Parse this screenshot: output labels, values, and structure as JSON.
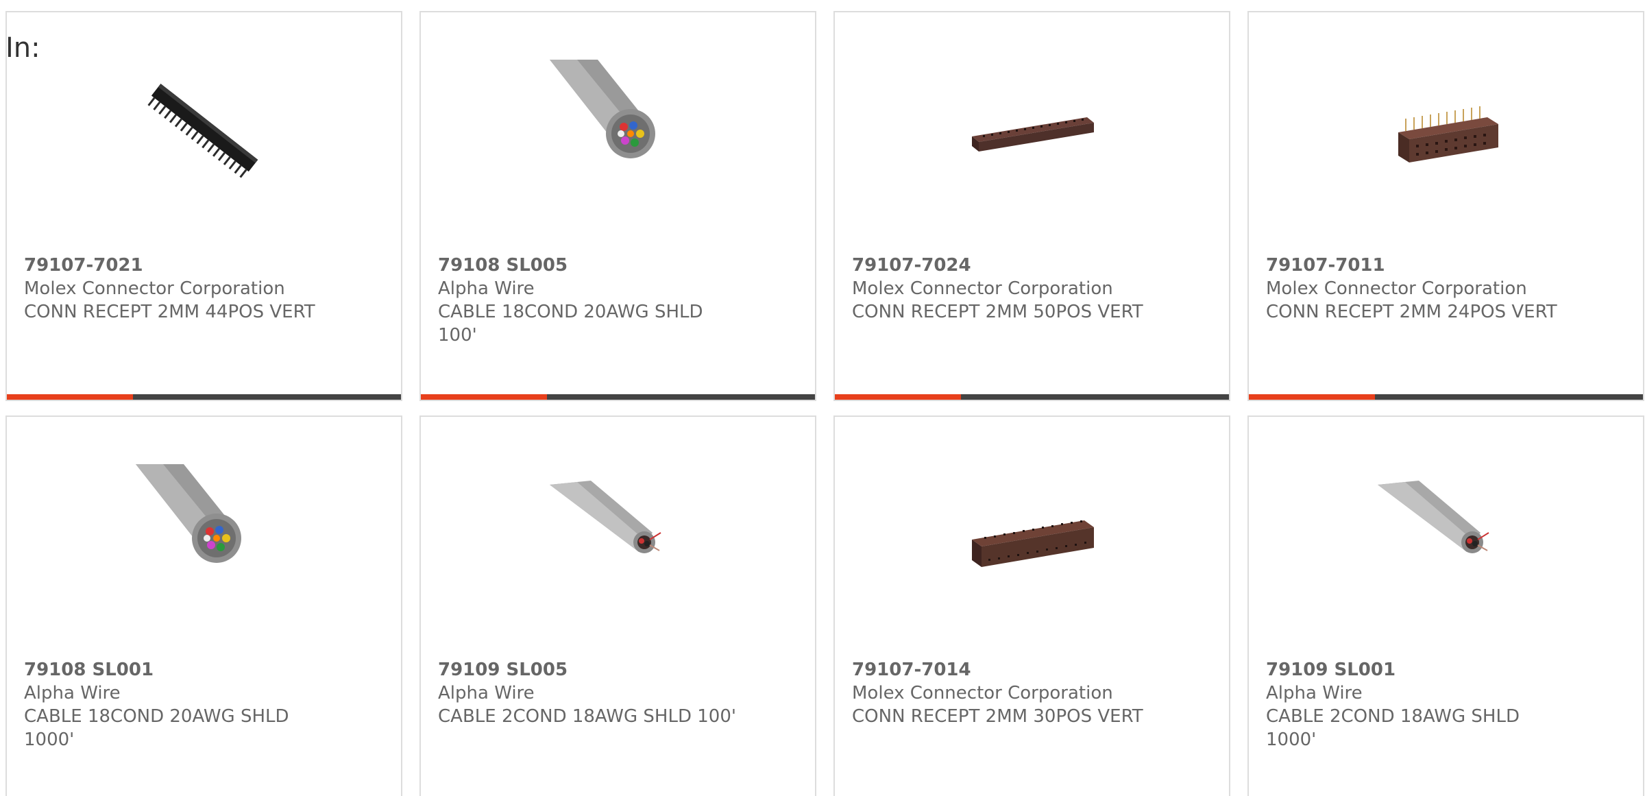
{
  "header": {
    "label": "In:"
  },
  "accent": {
    "active": "#e8401c",
    "track": "#444444"
  },
  "products": [
    {
      "part_number": "79107-7021",
      "manufacturer": "Molex Connector Corporation",
      "description": "CONN RECEPT 2MM 44POS VERT",
      "image": "connector-diagonal-icon",
      "progress_percent": 32
    },
    {
      "part_number": "79108 SL005",
      "manufacturer": "Alpha Wire",
      "description": "CABLE 18COND 20AWG SHLD 100'",
      "image": "multicore-cable-icon",
      "progress_percent": 32
    },
    {
      "part_number": "79107-7024",
      "manufacturer": "Molex Connector Corporation",
      "description": "CONN RECEPT 2MM 50POS VERT",
      "image": "connector-strip-icon",
      "progress_percent": 32
    },
    {
      "part_number": "79107-7011",
      "manufacturer": "Molex Connector Corporation",
      "description": "CONN RECEPT 2MM 24POS VERT",
      "image": "connector-block-icon",
      "progress_percent": 32
    },
    {
      "part_number": "79108 SL001",
      "manufacturer": "Alpha Wire",
      "description": "CABLE 18COND 20AWG SHLD 1000'",
      "image": "multicore-cable-icon"
    },
    {
      "part_number": "79109 SL005",
      "manufacturer": "Alpha Wire",
      "description": "CABLE 2COND 18AWG SHLD 100'",
      "image": "twocore-cable-icon"
    },
    {
      "part_number": "79107-7014",
      "manufacturer": "Molex Connector Corporation",
      "description": "CONN RECEPT 2MM 30POS VERT",
      "image": "connector-block-wide-icon"
    },
    {
      "part_number": "79109 SL001",
      "manufacturer": "Alpha Wire",
      "description": "CABLE 2COND 18AWG SHLD 1000'",
      "image": "twocore-cable-icon"
    }
  ]
}
